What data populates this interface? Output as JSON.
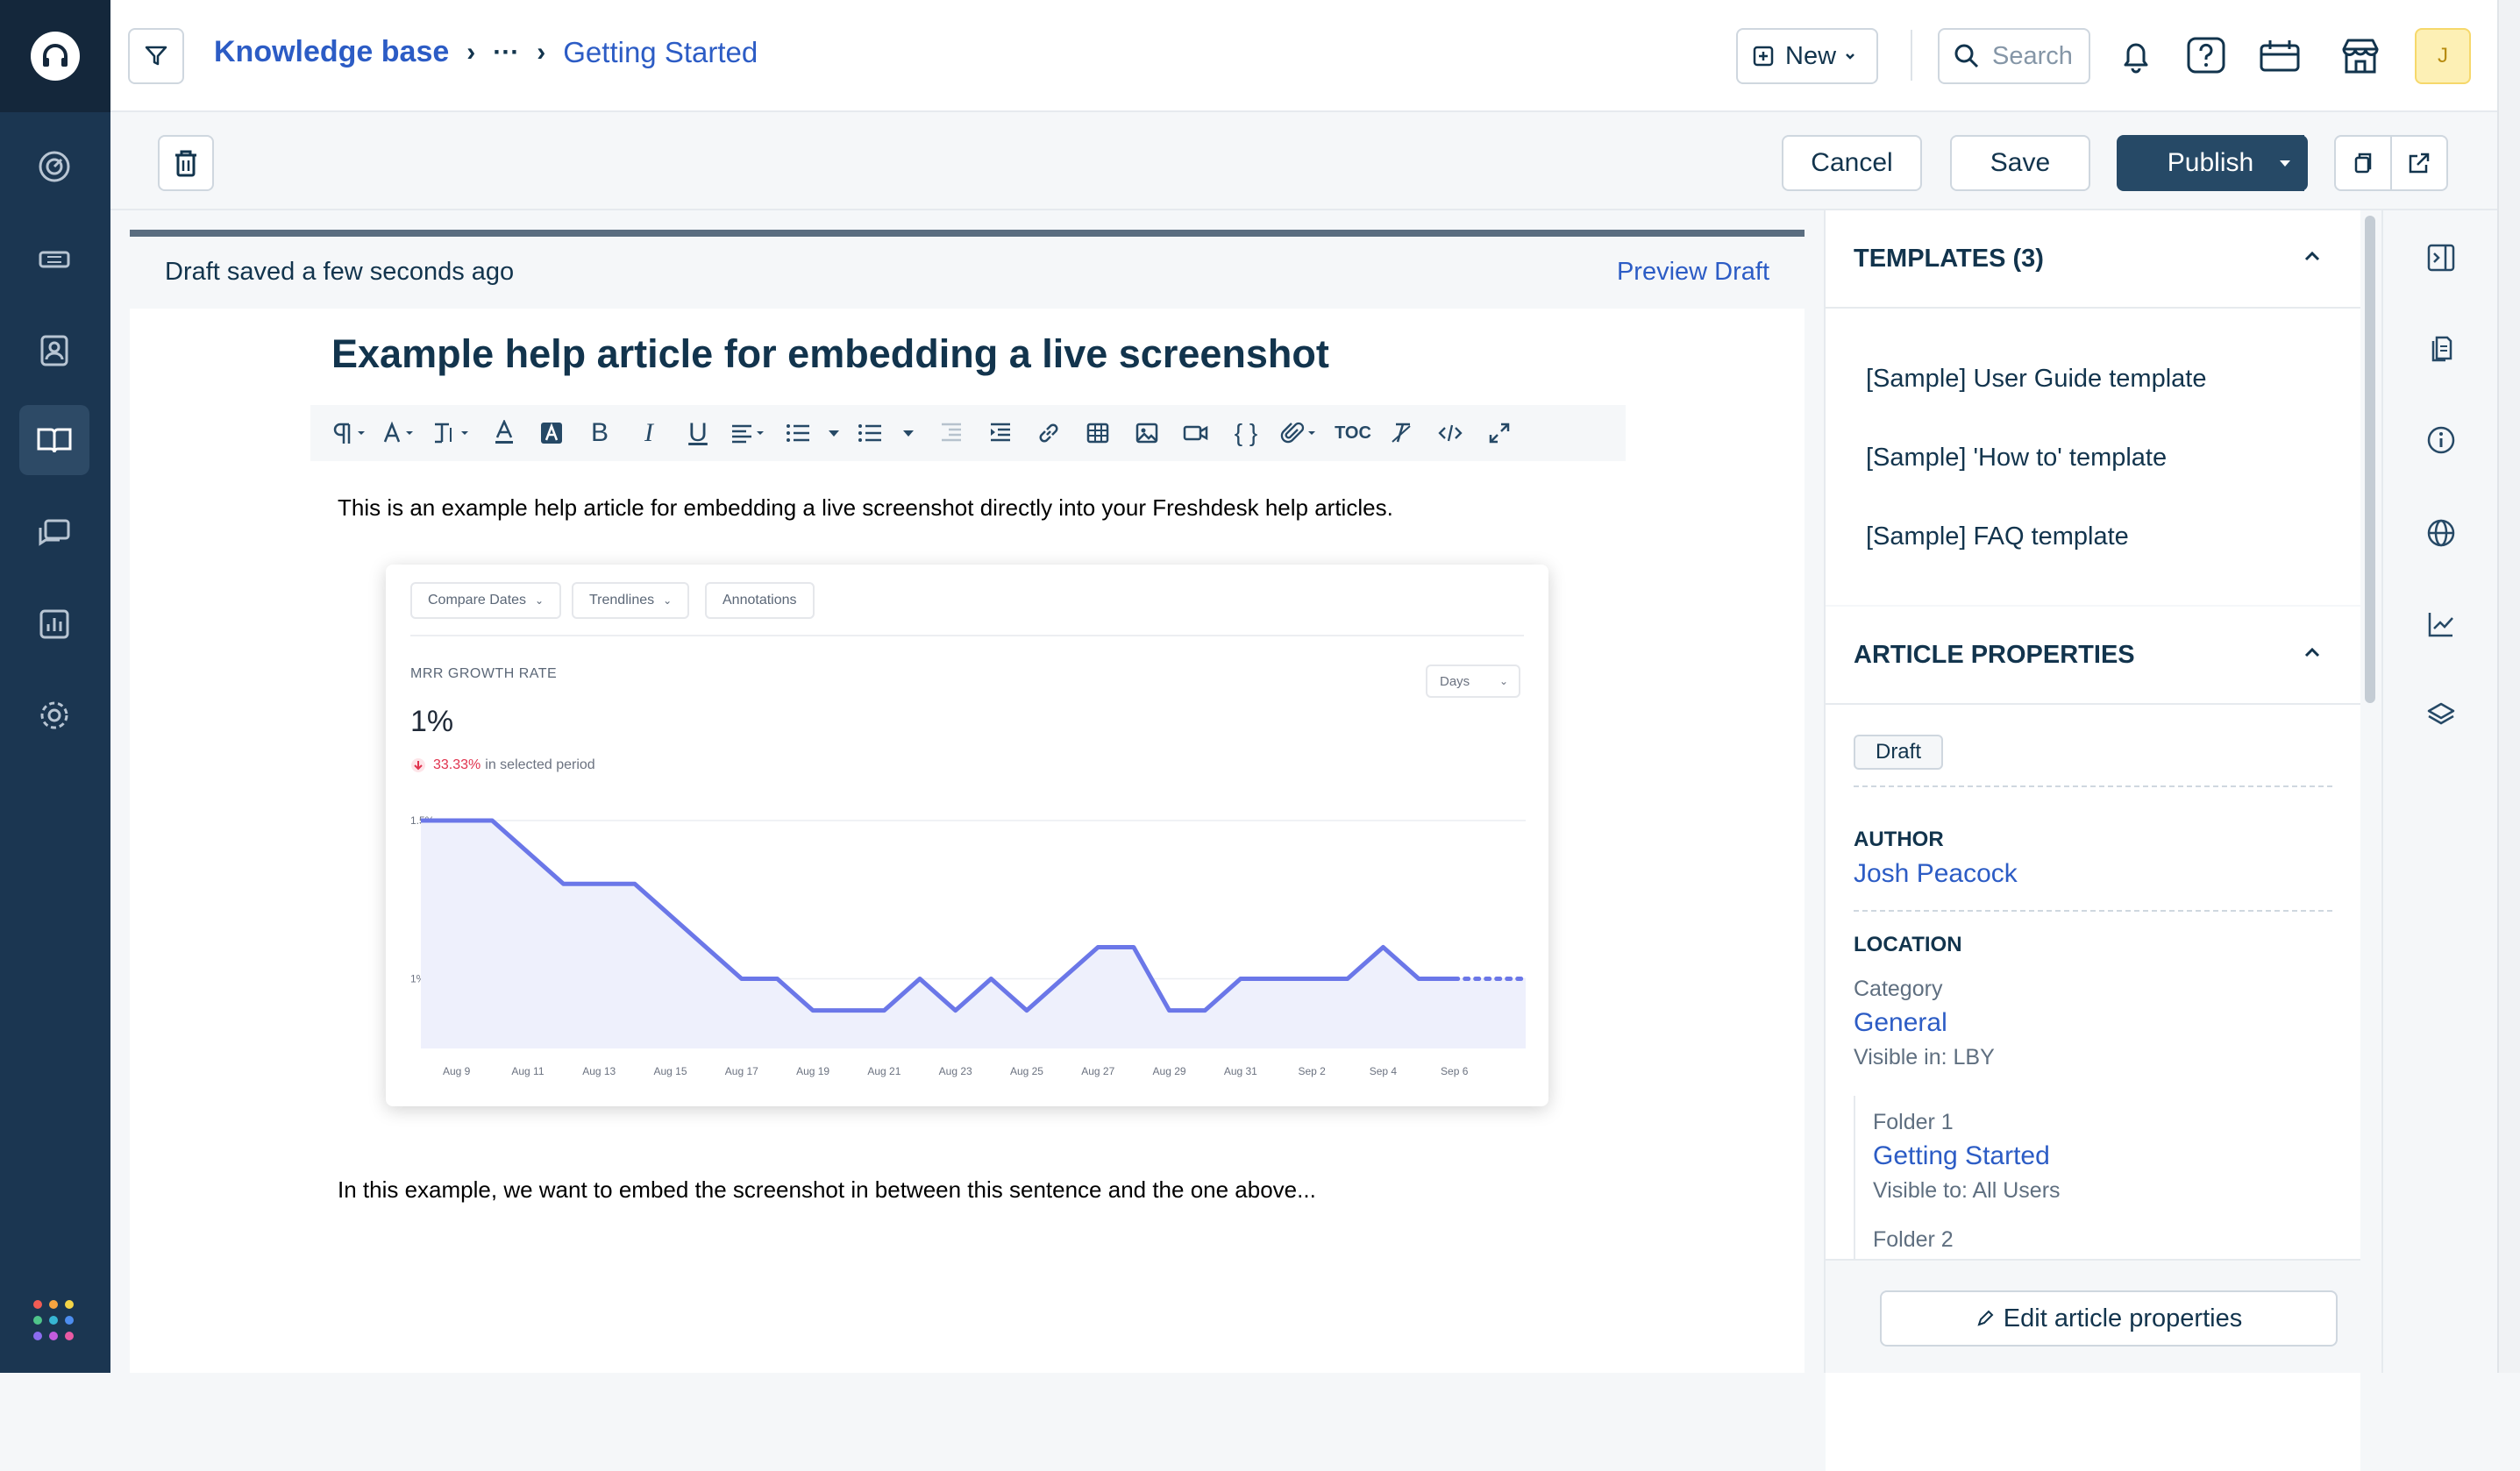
{
  "header": {
    "breadcrumb_root": "Knowledge base",
    "breadcrumb_ellipsis": "···",
    "breadcrumb_current": "Getting Started",
    "new_label": "New",
    "search_placeholder": "Search",
    "avatar_initial": "J"
  },
  "actionbar": {
    "cancel_label": "Cancel",
    "save_label": "Save",
    "publish_label": "Publish"
  },
  "editor": {
    "draft_status": "Draft saved a few seconds ago",
    "preview_label": "Preview Draft",
    "title": "Example help article for embedding a live screenshot",
    "paragraph_1": "This is an example help article for embedding a live screenshot directly into your Freshdesk help articles.",
    "paragraph_2": "In this example, we want to embed the screenshot in between this sentence and the one above...",
    "toolbar": [
      "paragraph-format-icon",
      "font-icon",
      "line-height-icon",
      "text-color-icon",
      "background-color-icon",
      "bold-icon",
      "italic-icon",
      "underline-icon",
      "align-icon",
      "ordered-list-icon",
      "unordered-list-icon",
      "outdent-icon",
      "indent-icon",
      "link-icon",
      "table-icon",
      "image-icon",
      "video-icon",
      "code-icon",
      "attachment-icon",
      "toc-icon",
      "clear-format-icon",
      "html-icon",
      "fullscreen-icon"
    ],
    "toolbar_toc_text": "TOC"
  },
  "screenshot": {
    "chips": [
      "Compare Dates",
      "Trendlines",
      "Annotations"
    ],
    "metric_label": "MRR GROWTH RATE",
    "metric_value": "1%",
    "delta_value": "33.33%",
    "delta_text": "in selected period",
    "period_select": "Days",
    "accent_color": "#6b77e8",
    "fill_color": "#eef0fc",
    "negative_color": "#e0334e"
  },
  "chart_data": {
    "type": "line",
    "x": [
      "Aug 8",
      "Aug 9",
      "Aug 10",
      "Aug 11",
      "Aug 12",
      "Aug 13",
      "Aug 14",
      "Aug 15",
      "Aug 16",
      "Aug 17",
      "Aug 18",
      "Aug 19",
      "Aug 20",
      "Aug 21",
      "Aug 22",
      "Aug 23",
      "Aug 24",
      "Aug 25",
      "Aug 26",
      "Aug 27",
      "Aug 28",
      "Aug 29",
      "Aug 30",
      "Aug 31",
      "Sep 1",
      "Sep 2",
      "Sep 3",
      "Sep 4",
      "Sep 5",
      "Sep 6",
      "Sep 7",
      "Sep 8"
    ],
    "x_tick_labels": [
      "Aug 9",
      "Aug 11",
      "Aug 13",
      "Aug 15",
      "Aug 17",
      "Aug 19",
      "Aug 21",
      "Aug 23",
      "Aug 25",
      "Aug 27",
      "Aug 29",
      "Aug 31",
      "Sep 2",
      "Sep 4",
      "Sep 6"
    ],
    "series": [
      {
        "values": [
          1.5,
          1.5,
          1.5,
          1.4,
          1.3,
          1.3,
          1.3,
          1.2,
          1.1,
          1.0,
          1.0,
          0.9,
          0.9,
          0.9,
          1.0,
          0.9,
          1.0,
          0.9,
          1.0,
          1.1,
          1.1,
          0.9,
          0.9,
          1.0,
          1.0,
          1.0,
          1.0,
          1.1,
          1.0,
          1.0,
          1.0,
          1.0
        ],
        "dotted_from_index": 29
      }
    ],
    "y_tick_labels": [
      "1.5%",
      "1%"
    ],
    "ylim": [
      0.78,
      1.5
    ],
    "grid": true
  },
  "templates": {
    "heading": "TEMPLATES (3)",
    "items": [
      "[Sample] User Guide template",
      "[Sample] 'How to' template",
      "[Sample] FAQ template"
    ]
  },
  "properties": {
    "heading": "ARTICLE PROPERTIES",
    "status": "Draft",
    "author_label": "AUTHOR",
    "author_name": "Josh Peacock",
    "location_label": "LOCATION",
    "category_label": "Category",
    "category_value": "General",
    "category_visibility": "Visible in: LBY",
    "folder1_label": "Folder 1",
    "folder1_value": "Getting Started",
    "folder1_visibility": "Visible to: All Users",
    "folder2_label": "Folder 2",
    "edit_label": "Edit article properties"
  }
}
